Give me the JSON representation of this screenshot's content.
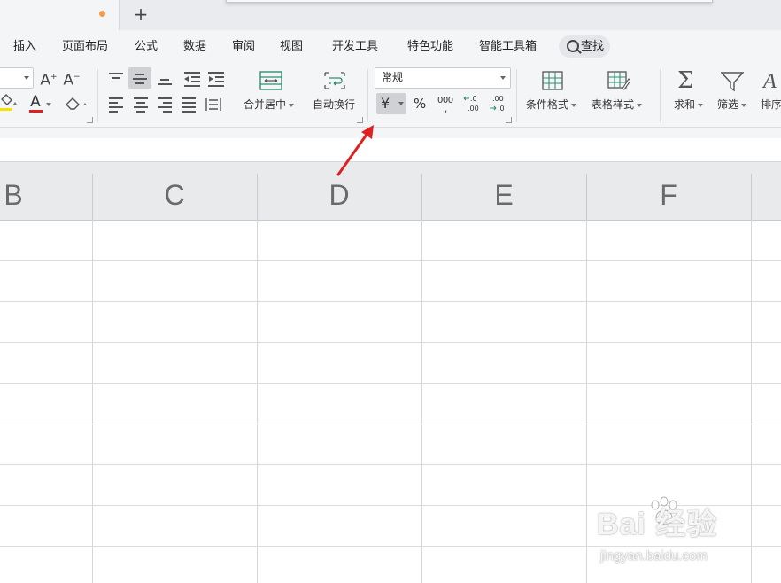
{
  "tabs": {
    "new_tab": "+"
  },
  "menu": {
    "items": [
      "插入",
      "页面布局",
      "公式",
      "数据",
      "审阅",
      "视图",
      "开发工具",
      "特色功能",
      "智能工具箱"
    ],
    "search_label": "查找"
  },
  "ribbon": {
    "font_inc": "A",
    "font_dec": "A",
    "font_color": "A",
    "merge_center": "合并居中",
    "wrap_text": "自动换行",
    "number_format": "常规",
    "currency_symbol": "¥",
    "percent": "%",
    "thousands": "000",
    "conditional_format": "条件格式",
    "table_style": "表格样式",
    "sum": "求和",
    "filter": "筛选",
    "sort": "排序"
  },
  "sheet": {
    "columns": [
      "B",
      "C",
      "D",
      "E",
      "F"
    ]
  },
  "watermark": {
    "logo": "Bai  经验",
    "url": "jingyan.baidu.com"
  },
  "colors": {
    "accent_red": "#e02020",
    "modified_dot": "#f29b4b",
    "font_color_bar": "#e02020"
  }
}
